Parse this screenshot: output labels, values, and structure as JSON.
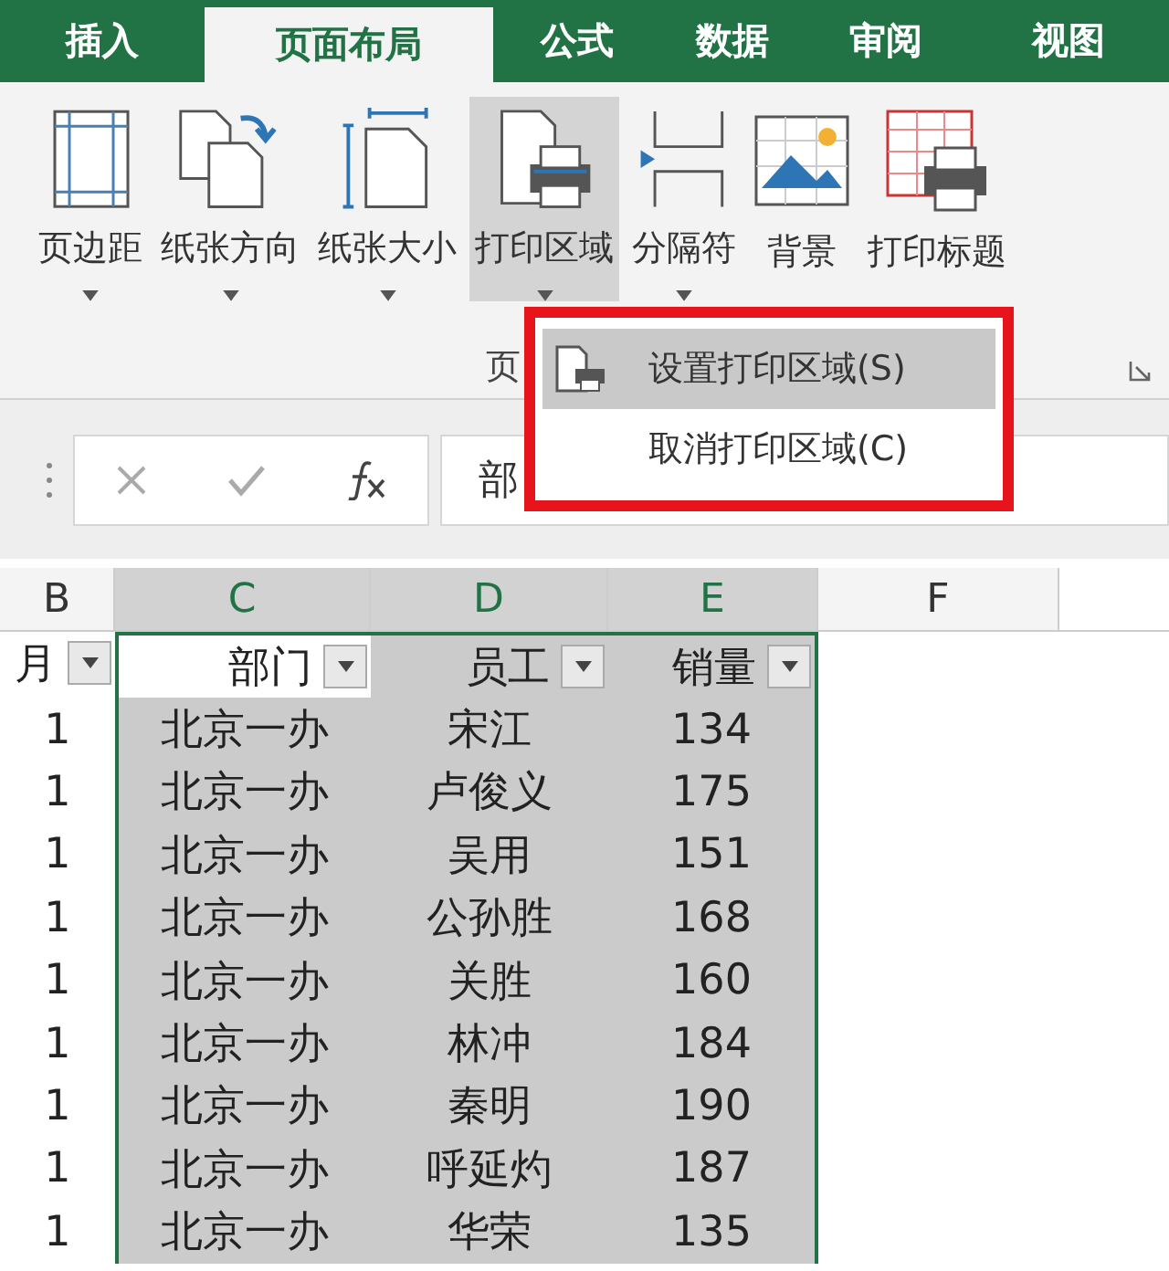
{
  "tabs": [
    {
      "label": "插入",
      "selected": false
    },
    {
      "label": "页面布局",
      "selected": true
    },
    {
      "label": "公式",
      "selected": false
    },
    {
      "label": "数据",
      "selected": false
    },
    {
      "label": "审阅",
      "selected": false
    },
    {
      "label": "视图",
      "selected": false
    }
  ],
  "ribbon": {
    "buttons": [
      {
        "kind": "margins",
        "label": "页边距",
        "has_menu": true,
        "pressed": false
      },
      {
        "kind": "orientation",
        "label": "纸张方向",
        "has_menu": true,
        "pressed": false
      },
      {
        "kind": "size",
        "label": "纸张大小",
        "has_menu": true,
        "pressed": false
      },
      {
        "kind": "print-area",
        "label": "打印区域",
        "has_menu": true,
        "pressed": true
      },
      {
        "kind": "breaks",
        "label": "分隔符",
        "has_menu": true,
        "pressed": false
      },
      {
        "kind": "background",
        "label": "背景",
        "has_menu": false,
        "pressed": false
      },
      {
        "kind": "print-titles",
        "label": "打印标题",
        "has_menu": false,
        "pressed": false
      }
    ],
    "group_label": "页"
  },
  "menu": {
    "items": [
      {
        "label": "设置打印区域(S)",
        "selected": true,
        "has_icon": true
      },
      {
        "label": "取消打印区域(C)",
        "selected": false,
        "has_icon": false
      }
    ]
  },
  "formula_bar": {
    "value": "部"
  },
  "columns": [
    {
      "label": "B",
      "selected": false
    },
    {
      "label": "C",
      "selected": true
    },
    {
      "label": "D",
      "selected": true
    },
    {
      "label": "E",
      "selected": true
    },
    {
      "label": "F",
      "selected": false
    }
  ],
  "header_row": [
    "月",
    "部门",
    "员工",
    "销量"
  ],
  "rows": [
    [
      "1",
      "北京一办",
      "宋江",
      "134"
    ],
    [
      "1",
      "北京一办",
      "卢俊义",
      "175"
    ],
    [
      "1",
      "北京一办",
      "吴用",
      "151"
    ],
    [
      "1",
      "北京一办",
      "公孙胜",
      "168"
    ],
    [
      "1",
      "北京一办",
      "关胜",
      "160"
    ],
    [
      "1",
      "北京一办",
      "林冲",
      "184"
    ],
    [
      "1",
      "北京一办",
      "秦明",
      "190"
    ],
    [
      "1",
      "北京一办",
      "呼延灼",
      "187"
    ],
    [
      "1",
      "北京一办",
      "华荣",
      "135"
    ]
  ]
}
